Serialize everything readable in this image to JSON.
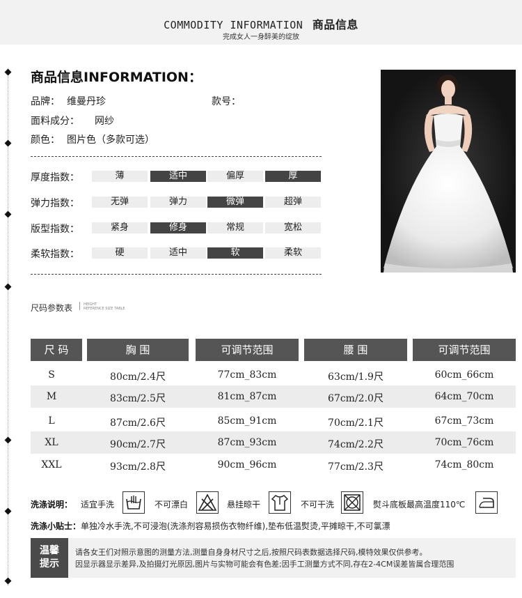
{
  "header": {
    "title_en": "COMMODITY INFORMATION",
    "title_zh": "商品信息",
    "subtitle": "完成女人一身醉美的绽放"
  },
  "info": {
    "section_title": "商品信息INFORMATION：",
    "brand_label": "品牌：",
    "brand_value": "维曼丹珍",
    "style_label": "款号：",
    "fabric_label": "面料成分：",
    "fabric_value": "网纱",
    "color_label": "颜色：",
    "color_value": "图片色（多款可选）"
  },
  "indices": [
    {
      "label": "厚度指数：",
      "options": [
        "薄",
        "适中",
        "偏厚",
        "厚"
      ],
      "selected": [
        1,
        3
      ]
    },
    {
      "label": "弹力指数：",
      "options": [
        "无弹",
        "弹力",
        "微弹",
        "超弹"
      ],
      "selected": [
        2
      ]
    },
    {
      "label": "版型指数：",
      "options": [
        "紧身",
        "修身",
        "常规",
        "宽松"
      ],
      "selected": [
        1
      ]
    },
    {
      "label": "柔软指数：",
      "options": [
        "硬",
        "适中",
        "软",
        "柔软"
      ],
      "selected": [
        2
      ]
    }
  ],
  "size_table": {
    "title": "尺码参数表",
    "title_en_1": "HEIGHT",
    "title_en_2": "REFERENCE SIZE TABLE",
    "headers": [
      "尺 码",
      "胸 围",
      "可调节范围",
      "腰 围",
      "可调节范围"
    ],
    "rows": [
      [
        "S",
        "80cm/2.4尺",
        "77cm_83cm",
        "63cm/1.9尺",
        "60cm_66cm"
      ],
      [
        "M",
        "83cm/2.5尺",
        "81cm_87cm",
        "67cm/2.0尺",
        "64cm_70cm"
      ],
      [
        "L",
        "87cm/2.6尺",
        "85cm_91cm",
        "70cm/2.1尺",
        "67cm_73cm"
      ],
      [
        "XL",
        "90cm/2.7尺",
        "87cm_93cm",
        "74cm/2.2尺",
        "70cm_76cm"
      ],
      [
        "XXL",
        "93cm/2.8尺",
        "90cm_96cm",
        "77cm/2.3尺",
        "74cm_80cm"
      ]
    ]
  },
  "washing": {
    "label": "洗涤说明：",
    "items": [
      {
        "text": "适宜手洗",
        "icon": "hand-wash-icon"
      },
      {
        "text": "不可漂白",
        "icon": "no-bleach-icon"
      },
      {
        "text": "悬挂晾干",
        "icon": "hang-dry-icon"
      },
      {
        "text": "不可干洗",
        "icon": "no-dry-clean-icon"
      },
      {
        "text": "熨斗底板最高温度110℃",
        "icon": "iron-icon"
      }
    ],
    "tips_label": "洗涤小贴士：",
    "tips_text": "单独冷水手洗,不可浸泡(洗涤剂容易损伤衣物纤维),垫布低温熨烫,平摊晾干,不可氯漂"
  },
  "notice": {
    "badge_line1": "温馨",
    "badge_line2": "提示",
    "line1": "请各女王们对照示意图的测量方法,测量自身身材尺寸之后,按照尺码表数据选择尺码,模特效果仅供参考。",
    "line2": "因显示器显示差异,及拍摄灯光原因,图片与实物可能会有色差;因手工测量方式不同,存在2-4CM误差皆属合理范围"
  },
  "colors": {
    "dark_cell": "#444444",
    "light_cell": "#ededed",
    "table_header": "#555555"
  }
}
